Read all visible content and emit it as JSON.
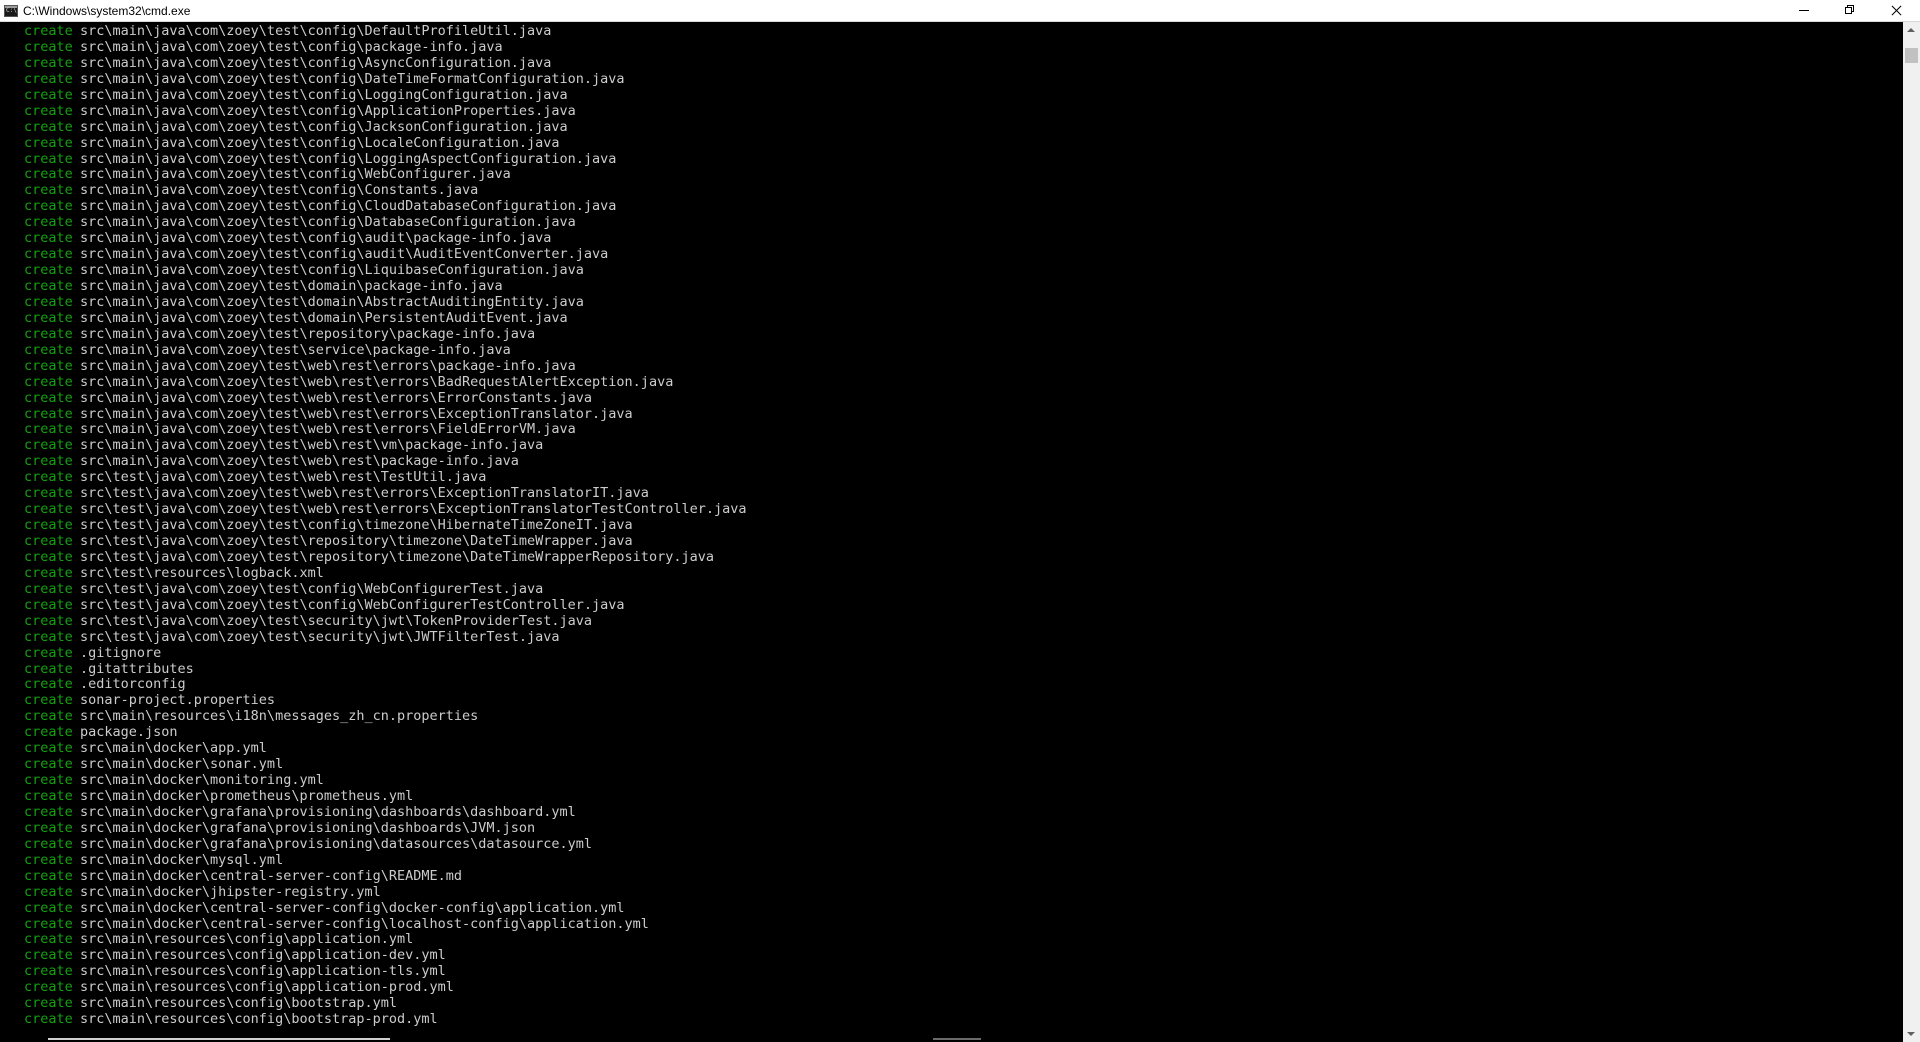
{
  "window": {
    "title": "C:\\Windows\\system32\\cmd.exe",
    "icon": "cmd-icon",
    "buttons": [
      "minimize-icon",
      "restore-icon",
      "close-icon"
    ]
  },
  "colors": {
    "background": "#000000",
    "verb": "#13a10e",
    "text": "#cccccc"
  },
  "console": {
    "verb": "create",
    "lines": [
      "src\\main\\java\\com\\zoey\\test\\config\\DefaultProfileUtil.java",
      "src\\main\\java\\com\\zoey\\test\\config\\package-info.java",
      "src\\main\\java\\com\\zoey\\test\\config\\AsyncConfiguration.java",
      "src\\main\\java\\com\\zoey\\test\\config\\DateTimeFormatConfiguration.java",
      "src\\main\\java\\com\\zoey\\test\\config\\LoggingConfiguration.java",
      "src\\main\\java\\com\\zoey\\test\\config\\ApplicationProperties.java",
      "src\\main\\java\\com\\zoey\\test\\config\\JacksonConfiguration.java",
      "src\\main\\java\\com\\zoey\\test\\config\\LocaleConfiguration.java",
      "src\\main\\java\\com\\zoey\\test\\config\\LoggingAspectConfiguration.java",
      "src\\main\\java\\com\\zoey\\test\\config\\WebConfigurer.java",
      "src\\main\\java\\com\\zoey\\test\\config\\Constants.java",
      "src\\main\\java\\com\\zoey\\test\\config\\CloudDatabaseConfiguration.java",
      "src\\main\\java\\com\\zoey\\test\\config\\DatabaseConfiguration.java",
      "src\\main\\java\\com\\zoey\\test\\config\\audit\\package-info.java",
      "src\\main\\java\\com\\zoey\\test\\config\\audit\\AuditEventConverter.java",
      "src\\main\\java\\com\\zoey\\test\\config\\LiquibaseConfiguration.java",
      "src\\main\\java\\com\\zoey\\test\\domain\\package-info.java",
      "src\\main\\java\\com\\zoey\\test\\domain\\AbstractAuditingEntity.java",
      "src\\main\\java\\com\\zoey\\test\\domain\\PersistentAuditEvent.java",
      "src\\main\\java\\com\\zoey\\test\\repository\\package-info.java",
      "src\\main\\java\\com\\zoey\\test\\service\\package-info.java",
      "src\\main\\java\\com\\zoey\\test\\web\\rest\\errors\\package-info.java",
      "src\\main\\java\\com\\zoey\\test\\web\\rest\\errors\\BadRequestAlertException.java",
      "src\\main\\java\\com\\zoey\\test\\web\\rest\\errors\\ErrorConstants.java",
      "src\\main\\java\\com\\zoey\\test\\web\\rest\\errors\\ExceptionTranslator.java",
      "src\\main\\java\\com\\zoey\\test\\web\\rest\\errors\\FieldErrorVM.java",
      "src\\main\\java\\com\\zoey\\test\\web\\rest\\vm\\package-info.java",
      "src\\main\\java\\com\\zoey\\test\\web\\rest\\package-info.java",
      "src\\test\\java\\com\\zoey\\test\\web\\rest\\TestUtil.java",
      "src\\test\\java\\com\\zoey\\test\\web\\rest\\errors\\ExceptionTranslatorIT.java",
      "src\\test\\java\\com\\zoey\\test\\web\\rest\\errors\\ExceptionTranslatorTestController.java",
      "src\\test\\java\\com\\zoey\\test\\config\\timezone\\HibernateTimeZoneIT.java",
      "src\\test\\java\\com\\zoey\\test\\repository\\timezone\\DateTimeWrapper.java",
      "src\\test\\java\\com\\zoey\\test\\repository\\timezone\\DateTimeWrapperRepository.java",
      "src\\test\\resources\\logback.xml",
      "src\\test\\java\\com\\zoey\\test\\config\\WebConfigurerTest.java",
      "src\\test\\java\\com\\zoey\\test\\config\\WebConfigurerTestController.java",
      "src\\test\\java\\com\\zoey\\test\\security\\jwt\\TokenProviderTest.java",
      "src\\test\\java\\com\\zoey\\test\\security\\jwt\\JWTFilterTest.java",
      ".gitignore",
      ".gitattributes",
      ".editorconfig",
      "sonar-project.properties",
      "src\\main\\resources\\i18n\\messages_zh_cn.properties",
      "package.json",
      "src\\main\\docker\\app.yml",
      "src\\main\\docker\\sonar.yml",
      "src\\main\\docker\\monitoring.yml",
      "src\\main\\docker\\prometheus\\prometheus.yml",
      "src\\main\\docker\\grafana\\provisioning\\dashboards\\dashboard.yml",
      "src\\main\\docker\\grafana\\provisioning\\dashboards\\JVM.json",
      "src\\main\\docker\\grafana\\provisioning\\datasources\\datasource.yml",
      "src\\main\\docker\\mysql.yml",
      "src\\main\\docker\\central-server-config\\README.md",
      "src\\main\\docker\\jhipster-registry.yml",
      "src\\main\\docker\\central-server-config\\docker-config\\application.yml",
      "src\\main\\docker\\central-server-config\\localhost-config\\application.yml",
      "src\\main\\resources\\config\\application.yml",
      "src\\main\\resources\\config\\application-dev.yml",
      "src\\main\\resources\\config\\application-tls.yml",
      "src\\main\\resources\\config\\application-prod.yml",
      "src\\main\\resources\\config\\bootstrap.yml",
      "src\\main\\resources\\config\\bootstrap-prod.yml"
    ]
  }
}
